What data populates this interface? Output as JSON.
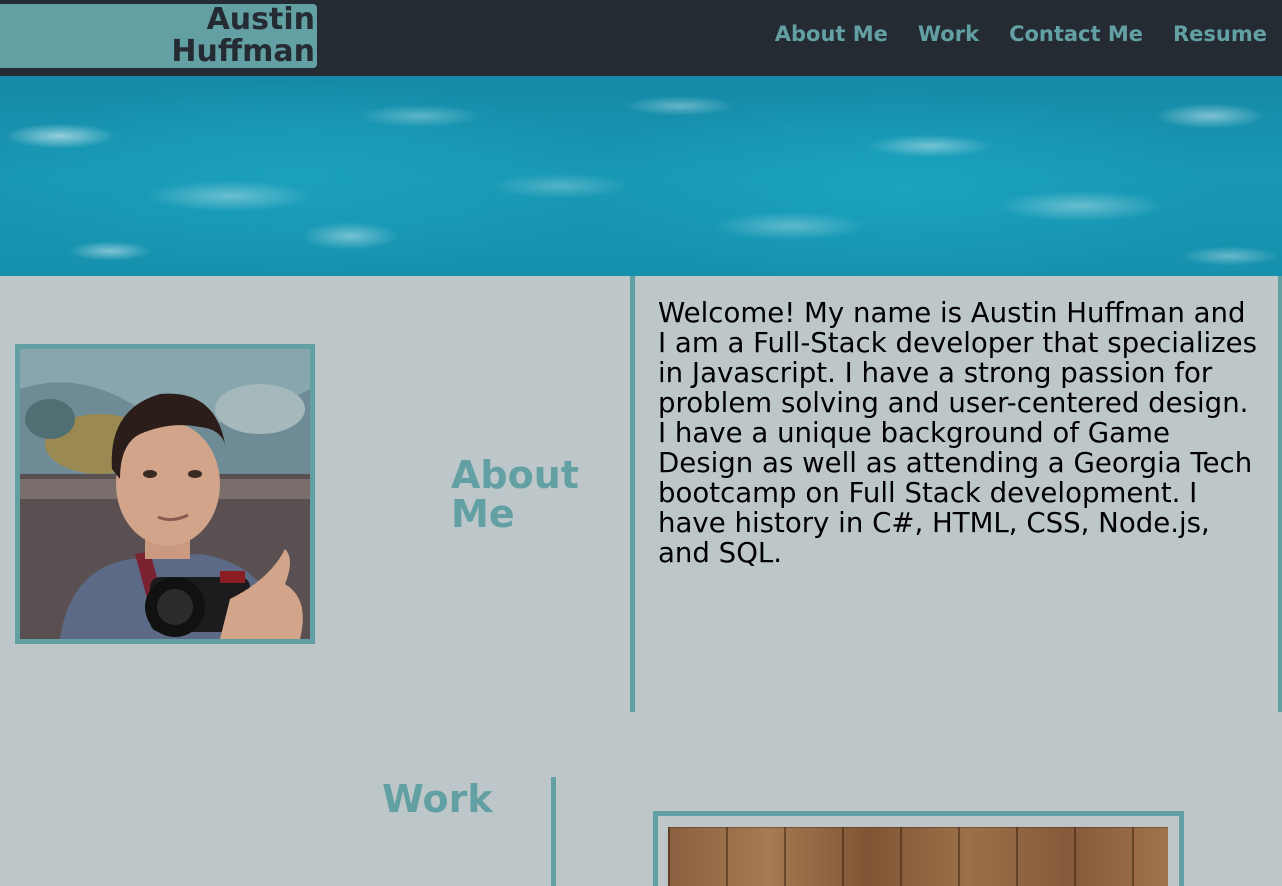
{
  "header": {
    "brand_line1": "Austin",
    "brand_line2": "Huffman",
    "nav": [
      {
        "label": "About Me"
      },
      {
        "label": "Work"
      },
      {
        "label": "Contact Me"
      },
      {
        "label": "Resume"
      }
    ]
  },
  "about": {
    "heading_line1": "About",
    "heading_line2": "Me",
    "text": "Welcome! My name is Austin Huffman and I am a Full-Stack developer that specializes in Javascript. I have a strong passion for problem solving and user-centered design. I have a unique background of Game Design as well as attending a Georgia Tech bootcamp on Full Stack development. I have history in C#, HTML, CSS, Node.js, and SQL."
  },
  "work": {
    "heading": "Work"
  },
  "colors": {
    "accent": "#63a0a4",
    "header_bg": "#242b33",
    "page_bg": "#bdc7ca"
  }
}
